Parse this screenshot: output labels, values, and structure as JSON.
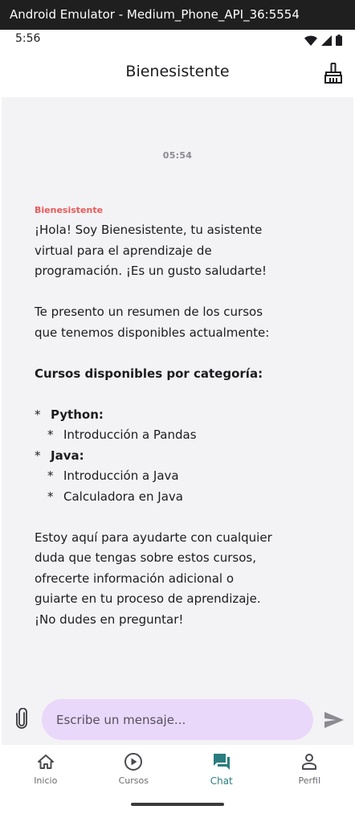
{
  "window": {
    "title": "Android Emulator - Medium_Phone_API_36:5554"
  },
  "status_bar": {
    "time": "5:56"
  },
  "app_bar": {
    "title": "Bienesistente",
    "action_icon": "broom-icon"
  },
  "chat": {
    "timestamp": "05:54",
    "message": {
      "sender": "Bienesistente",
      "lines": {
        "intro_1": "¡Hola! Soy Bienesistente, tu asistente",
        "intro_2": "virtual para el aprendizaje de",
        "intro_3": "programación. ¡Es un gusto saludarte!",
        "summary_1": "Te presento un resumen de los cursos",
        "summary_2": "que tenemos disponibles actualmente:",
        "heading": "Cursos disponibles por categoría:",
        "bullet_star": "*",
        "cat_python": "Python:",
        "course_pandas": "Introducción a Pandas",
        "cat_java": "Java:",
        "course_java_intro": "Introducción a Java",
        "course_java_calc": "Calculadora en Java",
        "closing_1": "Estoy aquí para ayudarte con cualquier",
        "closing_2": "duda que tengas sobre estos cursos,",
        "closing_3": "ofrecerte información adicional o",
        "closing_4": "guiarte en tu proceso de aprendizaje.",
        "closing_5": "¡No dudes en preguntar!"
      }
    }
  },
  "input": {
    "placeholder": "Escribe un mensaje...",
    "value": ""
  },
  "bottom_nav": {
    "items": [
      {
        "label": "Inicio",
        "icon": "home-icon",
        "active": false
      },
      {
        "label": "Cursos",
        "icon": "play-circle-icon",
        "active": false
      },
      {
        "label": "Chat",
        "icon": "chat-icon",
        "active": true
      },
      {
        "label": "Perfil",
        "icon": "person-icon",
        "active": false
      }
    ]
  },
  "colors": {
    "accent": "#2a7d7f",
    "sender": "#e85a5a",
    "input_bg": "#ead8fa",
    "chat_bg": "#f3f3f5"
  }
}
